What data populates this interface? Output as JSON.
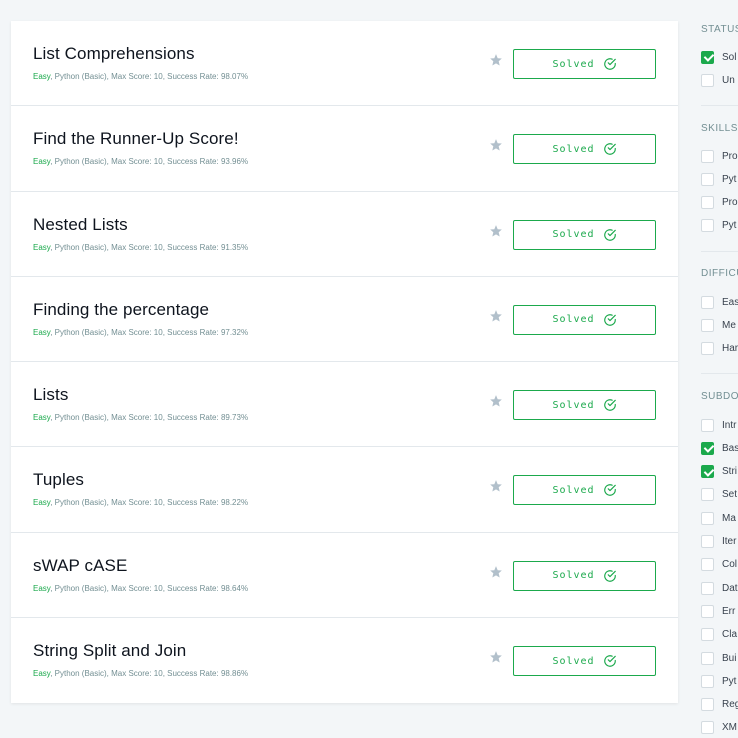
{
  "challenges": [
    {
      "title": "List Comprehensions",
      "difficulty": "Easy",
      "meta": ", Python (Basic), Max Score: 10, Success Rate: 98.07%",
      "status": "Solved"
    },
    {
      "title": "Find the Runner-Up Score!",
      "difficulty": "Easy",
      "meta": ", Python (Basic), Max Score: 10, Success Rate: 93.96%",
      "status": "Solved"
    },
    {
      "title": "Nested Lists",
      "difficulty": "Easy",
      "meta": ", Python (Basic), Max Score: 10, Success Rate: 91.35%",
      "status": "Solved"
    },
    {
      "title": "Finding the percentage",
      "difficulty": "Easy",
      "meta": ", Python (Basic), Max Score: 10, Success Rate: 97.32%",
      "status": "Solved"
    },
    {
      "title": "Lists",
      "difficulty": "Easy",
      "meta": ", Python (Basic), Max Score: 10, Success Rate: 89.73%",
      "status": "Solved"
    },
    {
      "title": "Tuples",
      "difficulty": "Easy",
      "meta": ", Python (Basic), Max Score: 10, Success Rate: 98.22%",
      "status": "Solved"
    },
    {
      "title": "sWAP cASE",
      "difficulty": "Easy",
      "meta": ", Python (Basic), Max Score: 10, Success Rate: 98.64%",
      "status": "Solved"
    },
    {
      "title": "String Split and Join",
      "difficulty": "Easy",
      "meta": ", Python (Basic), Max Score: 10, Success Rate: 98.86%",
      "status": "Solved"
    }
  ],
  "filters": {
    "status": {
      "heading": "STATUS",
      "options": [
        {
          "label": "Sol",
          "checked": true
        },
        {
          "label": "Un",
          "checked": false
        }
      ]
    },
    "skills": {
      "heading": "SKILLS",
      "options": [
        {
          "label": "Pro",
          "checked": false
        },
        {
          "label": "Pyt",
          "checked": false
        },
        {
          "label": "Pro",
          "checked": false
        },
        {
          "label": "Pyt",
          "checked": false
        }
      ]
    },
    "difficulty": {
      "heading": "DIFFICU",
      "options": [
        {
          "label": "Eas",
          "checked": false
        },
        {
          "label": "Me",
          "checked": false
        },
        {
          "label": "Har",
          "checked": false
        }
      ]
    },
    "subdomains": {
      "heading": "SUBDO",
      "options": [
        {
          "label": "Intr",
          "checked": false
        },
        {
          "label": "Bas",
          "checked": true
        },
        {
          "label": "Stri",
          "checked": true
        },
        {
          "label": "Set",
          "checked": false
        },
        {
          "label": "Ma",
          "checked": false
        },
        {
          "label": "Iter",
          "checked": false
        },
        {
          "label": "Col",
          "checked": false
        },
        {
          "label": "Dat",
          "checked": false
        },
        {
          "label": "Err",
          "checked": false
        },
        {
          "label": "Cla",
          "checked": false
        },
        {
          "label": "Bui",
          "checked": false
        },
        {
          "label": "Pyt",
          "checked": false
        },
        {
          "label": "Reg",
          "checked": false
        },
        {
          "label": "XM",
          "checked": false
        }
      ]
    }
  },
  "colors": {
    "accent": "#1ba94c",
    "star": "#b2c0cb",
    "meta": "#738f93"
  },
  "icons": {
    "bookmark": "star-icon",
    "solved": "check-circle-icon"
  }
}
